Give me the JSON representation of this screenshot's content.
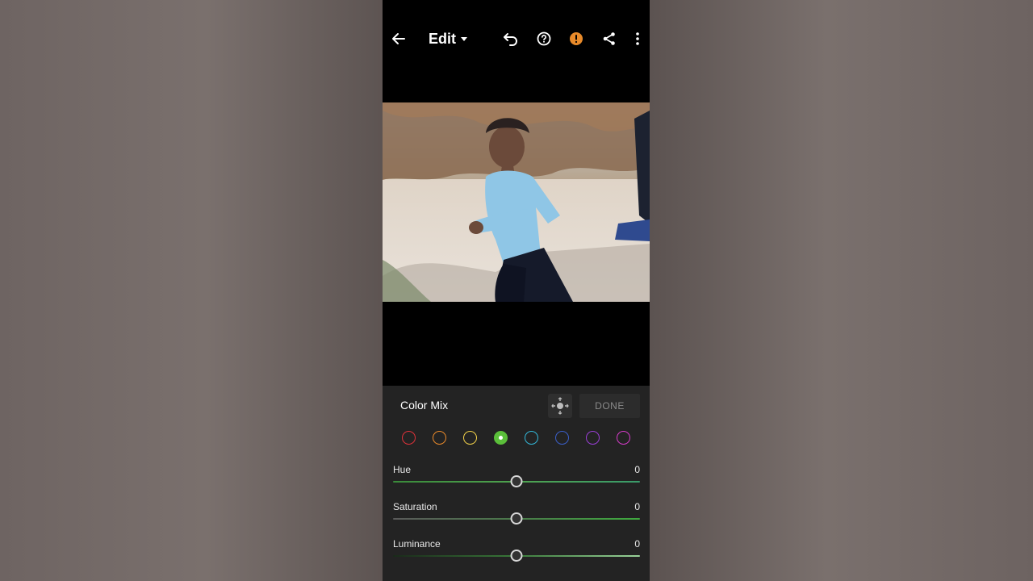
{
  "header": {
    "title": "Edit",
    "icons": [
      "back-arrow-icon",
      "undo-icon",
      "help-icon",
      "warning-icon",
      "share-icon",
      "more-vert-icon"
    ],
    "warning_color": "#e88a2a"
  },
  "photo": {
    "description_icon": "portrait-photo"
  },
  "panel": {
    "title": "Color Mix",
    "done_label": "DONE",
    "target_icon": "target-adjust-icon",
    "swatches": [
      {
        "name": "red",
        "color": "#e0323a"
      },
      {
        "name": "orange",
        "color": "#ea8a2a"
      },
      {
        "name": "yellow",
        "color": "#f2d14a"
      },
      {
        "name": "green",
        "color": "#5bbf3a"
      },
      {
        "name": "aqua",
        "color": "#33b7d8"
      },
      {
        "name": "blue",
        "color": "#3b5fc9"
      },
      {
        "name": "purple",
        "color": "#9a3fd6"
      },
      {
        "name": "magenta",
        "color": "#d53bc9"
      }
    ],
    "active_swatch": "green",
    "sliders": [
      {
        "label": "Hue",
        "value": "0",
        "level": 0.5
      },
      {
        "label": "Saturation",
        "value": "0",
        "level": 0.5
      },
      {
        "label": "Luminance",
        "value": "0",
        "level": 0.5
      }
    ]
  }
}
